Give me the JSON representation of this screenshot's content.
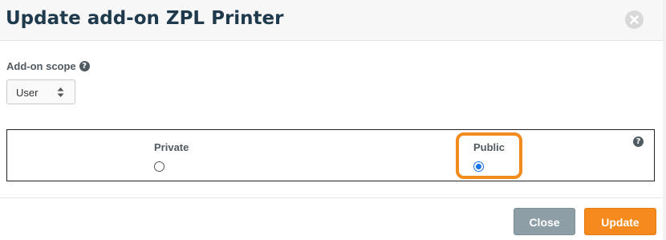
{
  "dialog": {
    "title": "Update add-on ZPL Printer",
    "close_icon": "circle-x-icon"
  },
  "scope": {
    "label": "Add-on scope",
    "help_icon": "question-circle-icon",
    "selected": "User"
  },
  "visibility": {
    "options": [
      {
        "label": "Private",
        "checked": false
      },
      {
        "label": "Public",
        "checked": true
      }
    ],
    "help_icon": "question-circle-icon"
  },
  "footer": {
    "close_label": "Close",
    "update_label": "Update"
  },
  "colors": {
    "title": "#1f3a4d",
    "highlight": "#f28a1c",
    "update_button": "#f68a1e",
    "close_button": "#8e9ea6",
    "radio_checked": "#1a73e8"
  }
}
